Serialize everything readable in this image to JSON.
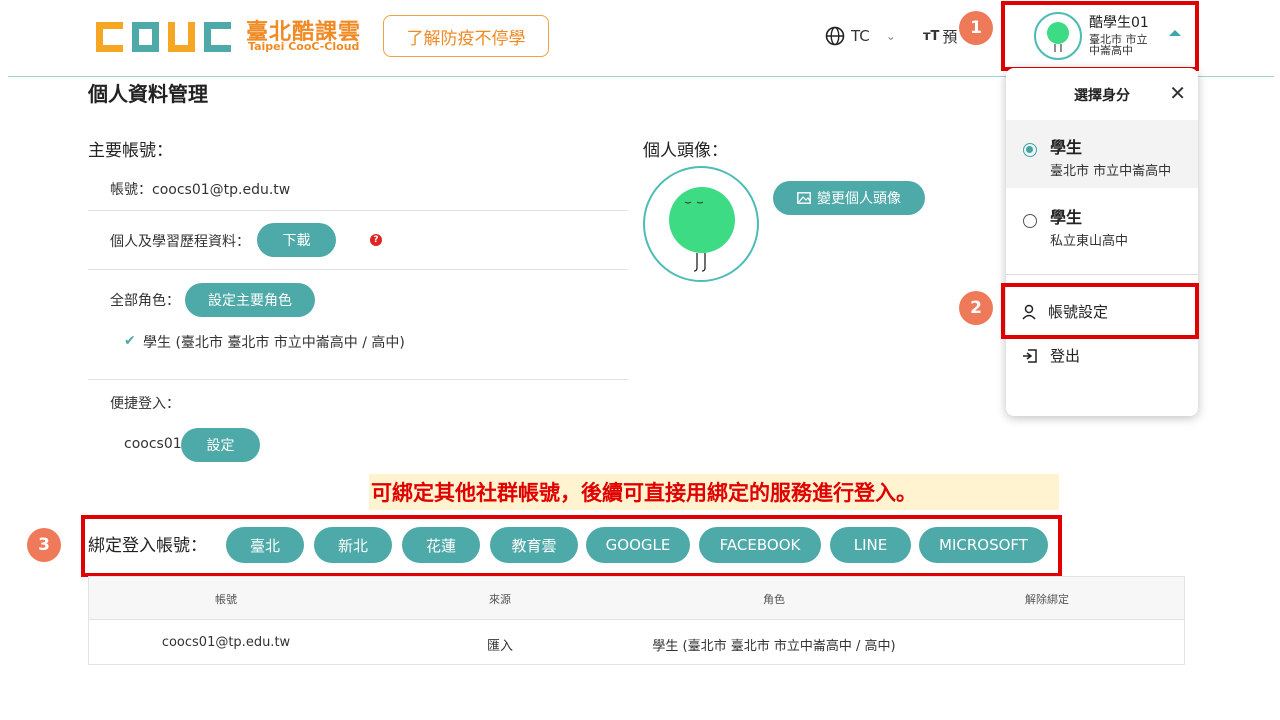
{
  "header": {
    "logo_text": "臺北酷課雲",
    "logo_subtext": "Taipei CooC-Cloud",
    "promo_button": "了解防疫不停學",
    "language": "TC",
    "font_size_label": "預",
    "user": {
      "name": "酷學生01",
      "school": "臺北市 市立中崙高中"
    }
  },
  "badges": {
    "one": "1",
    "two": "2",
    "three": "3"
  },
  "dropdown": {
    "title": "選擇身分",
    "identities": [
      {
        "role": "學生",
        "school": "臺北市 市立中崙高中",
        "selected": true
      },
      {
        "role": "學生",
        "school": "私立東山高中",
        "selected": false
      }
    ],
    "account_settings": "帳號設定",
    "logout": "登出"
  },
  "page": {
    "title": "個人資料管理",
    "primary_account_label": "主要帳號：",
    "account_line": "帳號：coocs01@tp.edu.tw",
    "learning_data_label": "個人及學習歷程資料：",
    "download_button": "下載",
    "all_roles_label": "全部角色：",
    "set_primary_role_button": "設定主要角色",
    "role_entry": "學生 (臺北市 臺北市 市立中崙高中 / 高中)",
    "quick_login_label": "便捷登入：",
    "quick_login_account": "coocs01",
    "set_button": "設定",
    "avatar_label": "個人頭像：",
    "change_avatar_button": "變更個人頭像"
  },
  "notice": "可綁定其他社群帳號，後續可直接用綁定的服務進行登入。",
  "binding": {
    "label": "綁定登入帳號：",
    "services": [
      "臺北",
      "新北",
      "花蓮",
      "教育雲",
      "GOOGLE",
      "FACEBOOK",
      "LINE",
      "MICROSOFT"
    ]
  },
  "table": {
    "headers": [
      "帳號",
      "來源",
      "角色",
      "解除綁定"
    ],
    "rows": [
      {
        "account": "coocs01@tp.edu.tw",
        "source": "匯入",
        "role": "學生 (臺北市 臺北市 市立中崙高中 / 高中)",
        "unbind": ""
      }
    ]
  },
  "colors": {
    "teal": "#4ea9a9",
    "orange": "#f08a24",
    "red": "#e00000",
    "badge": "#ee7a5a",
    "avatar_green": "#3ddc84"
  }
}
